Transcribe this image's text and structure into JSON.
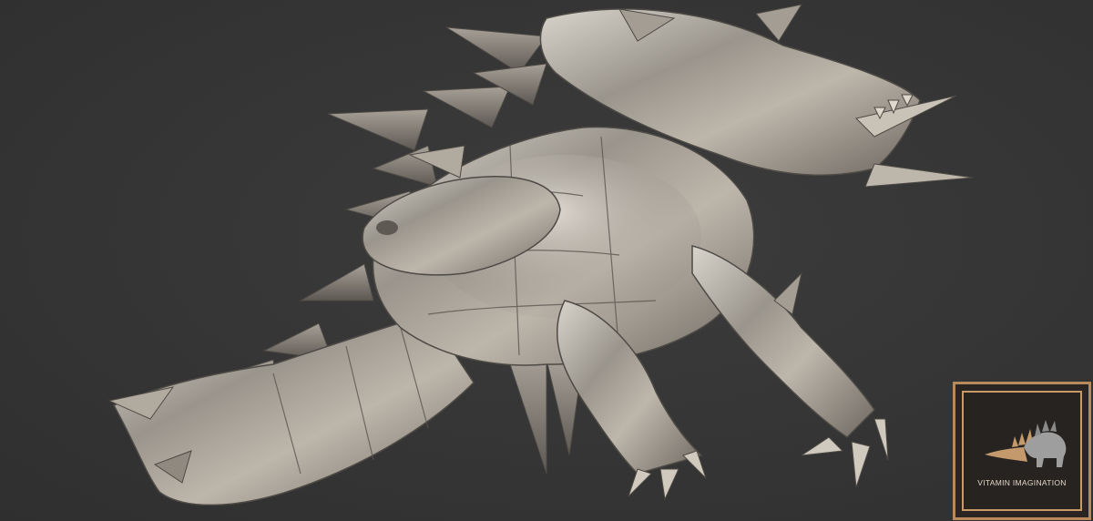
{
  "scene": {
    "subject_icon": "dragon-sculpture-render",
    "background_color": "#353535"
  },
  "watermark": {
    "text": "VITAMIN IMAGINATION",
    "icon": "stegosaurus-icon",
    "frame_color": "#b8895a",
    "text_color": "#e2d6c6"
  }
}
